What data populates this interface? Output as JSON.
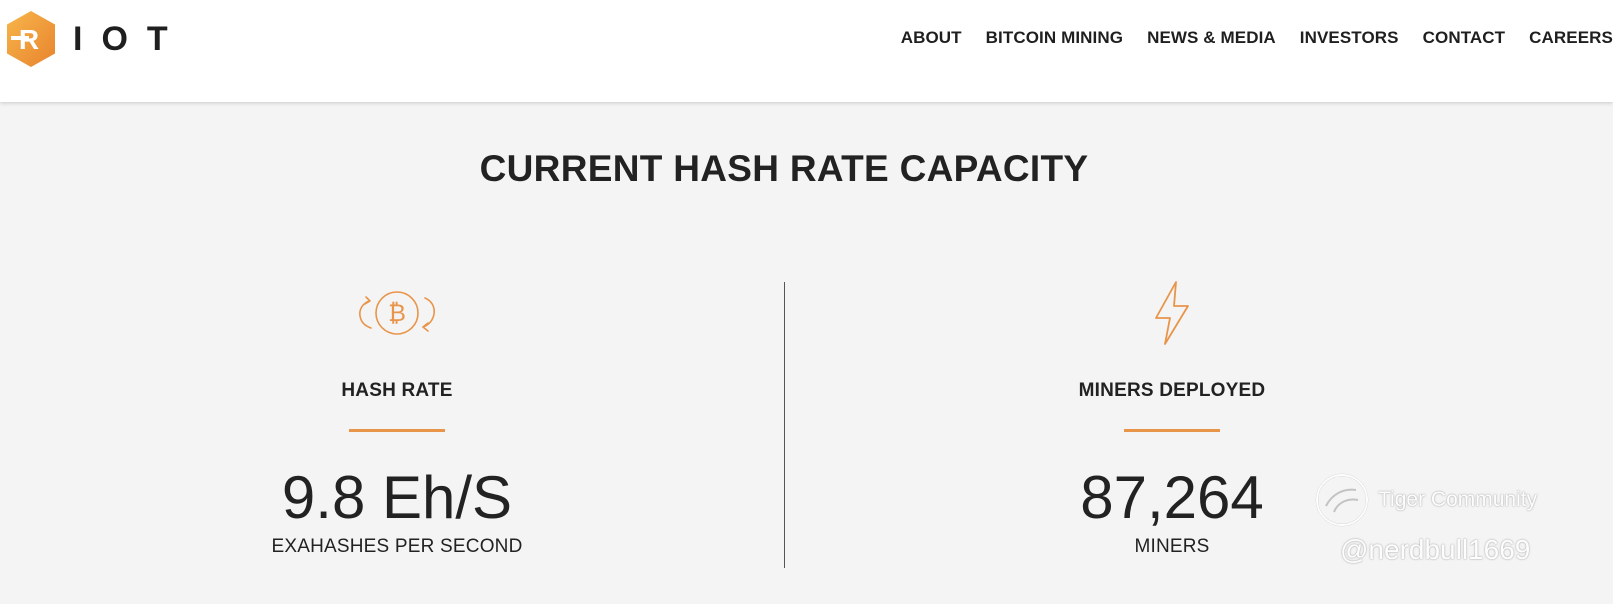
{
  "header": {
    "logo_text": "IOT",
    "logo_mark_letter": "R",
    "nav": [
      {
        "label": "ABOUT"
      },
      {
        "label": "BITCOIN MINING"
      },
      {
        "label": "NEWS & MEDIA"
      },
      {
        "label": "INVESTORS"
      },
      {
        "label": "CONTACT"
      },
      {
        "label": "CAREERS"
      }
    ]
  },
  "main": {
    "title": "CURRENT HASH RATE CAPACITY",
    "stats": [
      {
        "icon": "bitcoin-exchange-icon",
        "label": "HASH RATE",
        "value": "9.8 Eh/S",
        "unit": "EXAHASHES PER SECOND"
      },
      {
        "icon": "lightning-bolt-icon",
        "label": "MINERS DEPLOYED",
        "value": "87,264",
        "unit": "MINERS"
      }
    ]
  },
  "watermark": {
    "brand": "Tiger Community",
    "handle": "@nerdbull1669"
  },
  "colors": {
    "accent": "#e8954a",
    "logo_orange": "#f0a23e",
    "text": "#222222",
    "background": "#f4f4f4",
    "header_bg": "#ffffff"
  }
}
